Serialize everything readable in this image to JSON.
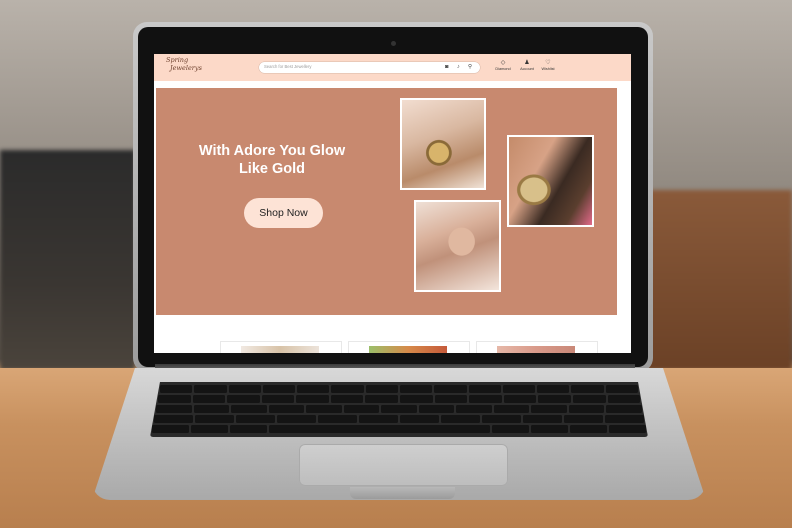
{
  "site": {
    "logo": {
      "line1": "Spring",
      "line2": "Jewelerys"
    },
    "search": {
      "placeholder": "Search for Best Jewellery"
    },
    "search_icons": [
      "camera-icon",
      "microphone-icon",
      "search-icon"
    ],
    "nav": [
      {
        "label": "Diamond",
        "icon": "diamond-icon",
        "glyph": "◇"
      },
      {
        "label": "Account",
        "icon": "account-icon",
        "glyph": "♟"
      },
      {
        "label": "Wishlist",
        "icon": "heart-icon",
        "glyph": "♡"
      }
    ],
    "hero": {
      "title": "With Adore You Glow Like Gold",
      "button_label": "Shop Now",
      "background": "#c8896f",
      "button_color": "#fde3d6"
    },
    "header_color": "#fcd9c8",
    "product_cards": 3
  }
}
